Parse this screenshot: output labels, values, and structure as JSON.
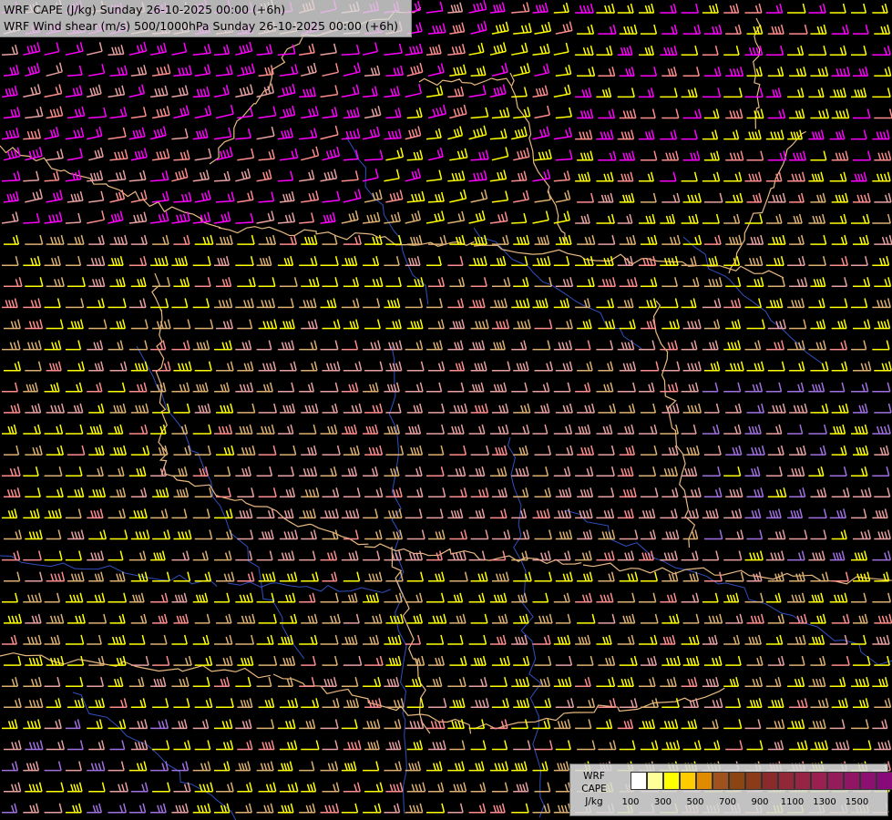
{
  "header": {
    "line1": "WRF CAPE (J/kg) Sunday 26-10-2025 00:00 (+6h)",
    "line2": "WRF Wind shear (m/s) 500/1000hPa Sunday 26-10-2025 00:00 (+6h)"
  },
  "legend": {
    "label_model": "WRF",
    "label_field": "CAPE",
    "label_unit": "J/kg",
    "colors": [
      "#ffffff",
      "#ffff99",
      "#ffff00",
      "#ffcc00",
      "#e08a00",
      "#a0521e",
      "#8b4513",
      "#8b3a1a",
      "#8b2a2a",
      "#902838",
      "#962545",
      "#9a2050",
      "#951c5a",
      "#901665",
      "#8c1070",
      "#880a7a",
      "#800080"
    ],
    "ticks": [
      "100",
      "300",
      "500",
      "700",
      "900",
      "1100",
      "1300",
      "1500"
    ]
  },
  "map_colors": {
    "magenta": "#ff00ff",
    "yellow": "#ffff00",
    "salmon": "#ff8c8c",
    "tan": "#ddb070",
    "pink": "#e8a0a0",
    "violet": "#a070e0",
    "border": "#e8b880",
    "river": "#3050c0",
    "coast": "#c8c8c8"
  }
}
